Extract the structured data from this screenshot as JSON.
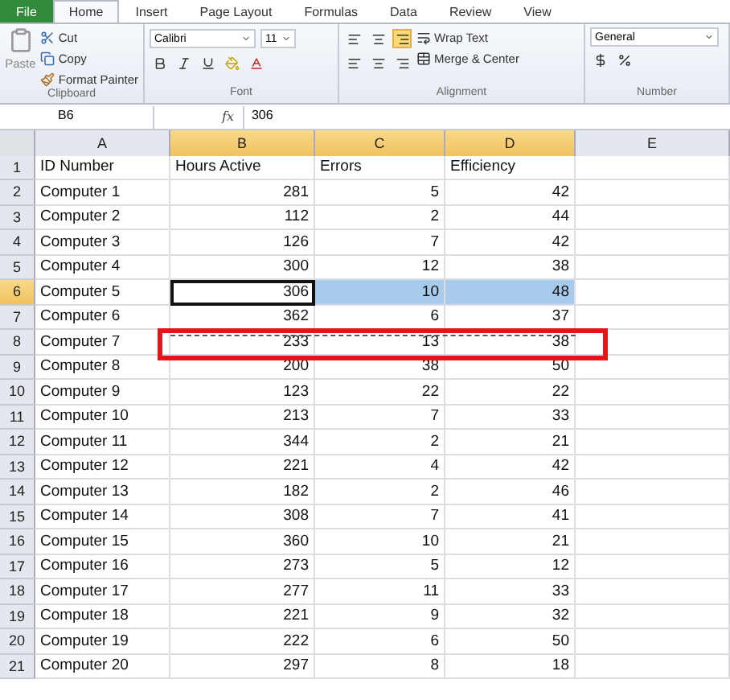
{
  "ribbon_tabs": [
    {
      "label": "File",
      "selected": false,
      "kind": "file"
    },
    {
      "label": "Home",
      "selected": true,
      "kind": "tab"
    },
    {
      "label": "Insert",
      "selected": false,
      "kind": "tab"
    },
    {
      "label": "Page Layout",
      "selected": false,
      "kind": "tab"
    },
    {
      "label": "Formulas",
      "selected": false,
      "kind": "tab"
    },
    {
      "label": "Data",
      "selected": false,
      "kind": "tab"
    },
    {
      "label": "Review",
      "selected": false,
      "kind": "tab"
    },
    {
      "label": "View",
      "selected": false,
      "kind": "tab"
    }
  ],
  "clipboard": {
    "label": "Clipboard",
    "paste": "Paste",
    "cut": "Cut",
    "copy": "Copy",
    "format_painter": "Format Painter"
  },
  "font": {
    "label": "Font",
    "font_name": "Calibri",
    "font_size": "11"
  },
  "alignment": {
    "label": "Alignment",
    "wrap_text": "Wrap Text",
    "merge": "Merge & Center"
  },
  "number": {
    "label": "Number",
    "format": "General"
  },
  "formula_bar": {
    "name_box": "B6",
    "function_label": "fx",
    "value": "306"
  },
  "columns": [
    {
      "label": "A",
      "selected": false
    },
    {
      "label": "B",
      "selected": true
    },
    {
      "label": "C",
      "selected": true
    },
    {
      "label": "D",
      "selected": true
    },
    {
      "label": "E",
      "selected": false
    }
  ],
  "rows": [
    {
      "number": "1",
      "selected": false,
      "cells": [
        "ID Number",
        "Hours Active",
        "Errors",
        "Efficiency"
      ]
    },
    {
      "number": "2",
      "selected": false,
      "cells": [
        "Computer 1",
        "281",
        "5",
        "42"
      ]
    },
    {
      "number": "3",
      "selected": false,
      "cells": [
        "Computer 2",
        "112",
        "2",
        "44"
      ]
    },
    {
      "number": "4",
      "selected": false,
      "cells": [
        "Computer 3",
        "126",
        "7",
        "42"
      ]
    },
    {
      "number": "5",
      "selected": false,
      "cells": [
        "Computer 4",
        "300",
        "12",
        "38"
      ]
    },
    {
      "number": "6",
      "selected": true,
      "cells": [
        "Computer 5",
        "306",
        "10",
        "48"
      ]
    },
    {
      "number": "7",
      "selected": false,
      "cells": [
        "Computer 6",
        "362",
        "6",
        "37"
      ]
    },
    {
      "number": "8",
      "selected": false,
      "cells": [
        "Computer 7",
        "233",
        "13",
        "38"
      ]
    },
    {
      "number": "9",
      "selected": false,
      "cells": [
        "Computer 8",
        "200",
        "38",
        "50"
      ]
    },
    {
      "number": "10",
      "selected": false,
      "cells": [
        "Computer 9",
        "123",
        "22",
        "22"
      ]
    },
    {
      "number": "11",
      "selected": false,
      "cells": [
        "Computer 10",
        "213",
        "7",
        "33"
      ]
    },
    {
      "number": "12",
      "selected": false,
      "cells": [
        "Computer 11",
        "344",
        "2",
        "21"
      ]
    },
    {
      "number": "13",
      "selected": false,
      "cells": [
        "Computer 12",
        "221",
        "4",
        "42"
      ]
    },
    {
      "number": "14",
      "selected": false,
      "cells": [
        "Computer 13",
        "182",
        "2",
        "46"
      ]
    },
    {
      "number": "15",
      "selected": false,
      "cells": [
        "Computer 14",
        "308",
        "7",
        "41"
      ]
    },
    {
      "number": "16",
      "selected": false,
      "cells": [
        "Computer 15",
        "360",
        "10",
        "21"
      ]
    },
    {
      "number": "17",
      "selected": false,
      "cells": [
        "Computer 16",
        "273",
        "5",
        "12"
      ]
    },
    {
      "number": "18",
      "selected": false,
      "cells": [
        "Computer 17",
        "277",
        "11",
        "33"
      ]
    },
    {
      "number": "19",
      "selected": false,
      "cells": [
        "Computer 18",
        "221",
        "9",
        "32"
      ]
    },
    {
      "number": "20",
      "selected": false,
      "cells": [
        "Computer 19",
        "222",
        "6",
        "50"
      ]
    },
    {
      "number": "21",
      "selected": false,
      "cells": [
        "Computer 20",
        "297",
        "8",
        "18"
      ]
    }
  ],
  "move_marker": {
    "visible": true
  }
}
